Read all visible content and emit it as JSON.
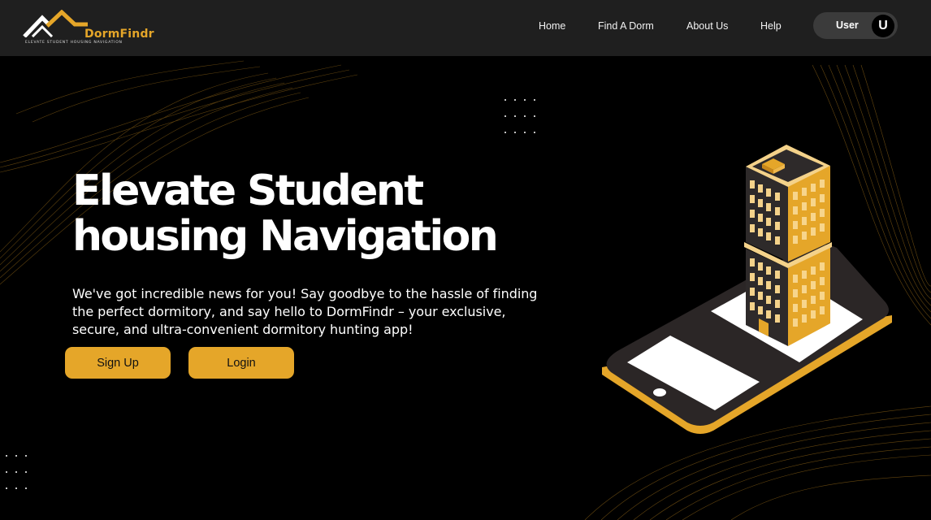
{
  "brand": {
    "name": "DormFindr",
    "tagline": "ELEVATE STUDENT HOUSING NAVIGATION"
  },
  "nav": {
    "links": [
      {
        "label": "Home"
      },
      {
        "label": "Find A Dorm"
      },
      {
        "label": "About Us"
      },
      {
        "label": "Help"
      }
    ],
    "user": {
      "label": "User",
      "avatar_initial": "U"
    }
  },
  "hero": {
    "title_line1": "Elevate Student",
    "title_line2": "housing Navigation",
    "body": "We've got incredible news for you! Say goodbye to the hassle of finding the perfect dormitory, and say hello to DormFindr – your exclusive, secure, and ultra-convenient dormitory hunting app!",
    "signup_label": "Sign Up",
    "login_label": "Login"
  },
  "colors": {
    "accent": "#e5a629",
    "nav_bg": "#1f1f1f",
    "page_bg": "#000000",
    "user_pill": "#3b3b3b"
  },
  "icons": [
    "house-roof-logo-icon",
    "user-avatar-icon"
  ]
}
